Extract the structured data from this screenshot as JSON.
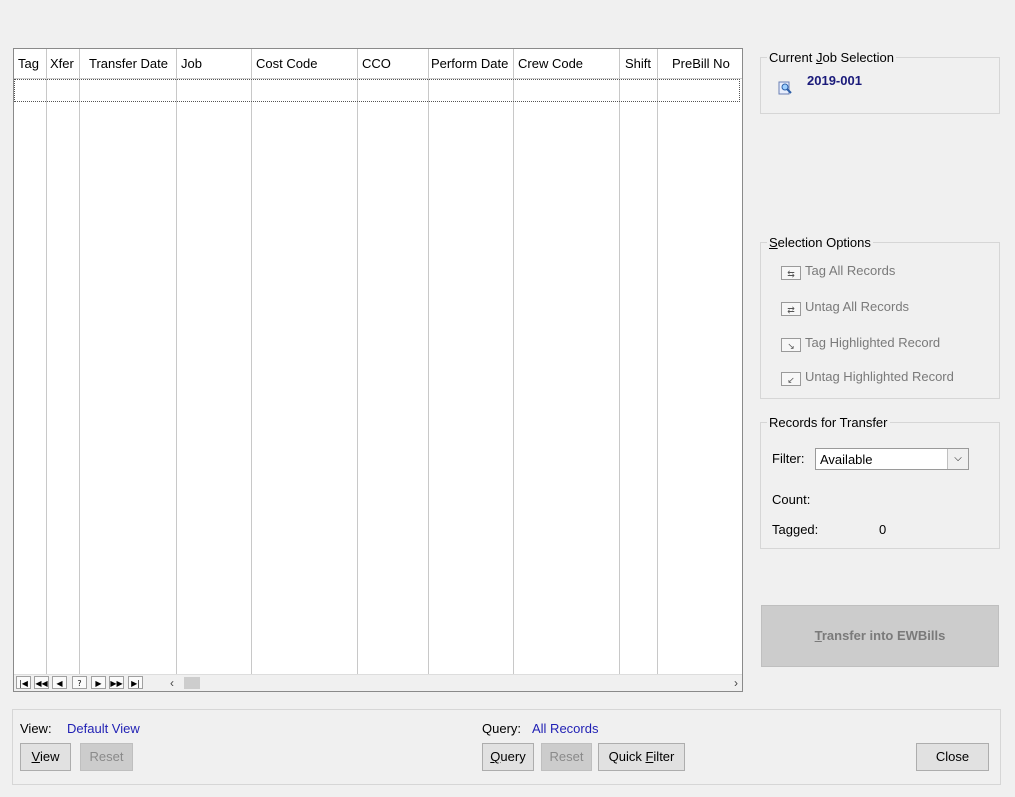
{
  "grid": {
    "columns": [
      "Tag",
      "Xfer",
      "Transfer Date",
      "Job",
      "Cost Code",
      "CCO",
      "Perform Date",
      "Crew Code",
      "Shift",
      "PreBill No"
    ],
    "nav_buttons": [
      "first",
      "prev-page",
      "prev",
      "help",
      "next",
      "next-page",
      "last"
    ]
  },
  "current_job": {
    "title": "Current Job Selection",
    "value": "2019-001"
  },
  "selection_options": {
    "title": "Selection Options",
    "items": [
      "Tag All Records",
      "Untag All Records",
      "Tag Highlighted Record",
      "Untag Highlighted Record"
    ]
  },
  "records_transfer": {
    "title": "Records for Transfer",
    "filter_label": "Filter:",
    "filter_value": "Available",
    "count_label": "Count:",
    "count_value": "",
    "tagged_label": "Tagged:",
    "tagged_value": "0"
  },
  "transfer_button": "Transfer into EWBills",
  "bottom": {
    "view_label": "View:",
    "view_value": "Default View",
    "view_button": "View",
    "view_reset": "Reset",
    "query_label": "Query:",
    "query_value": "All Records",
    "query_button": "Query",
    "query_reset": "Reset",
    "quick_filter": "Quick Filter",
    "close": "Close"
  },
  "colors": {
    "link_blue": "#1f1fb4",
    "job_blue": "#1a1a7a"
  }
}
